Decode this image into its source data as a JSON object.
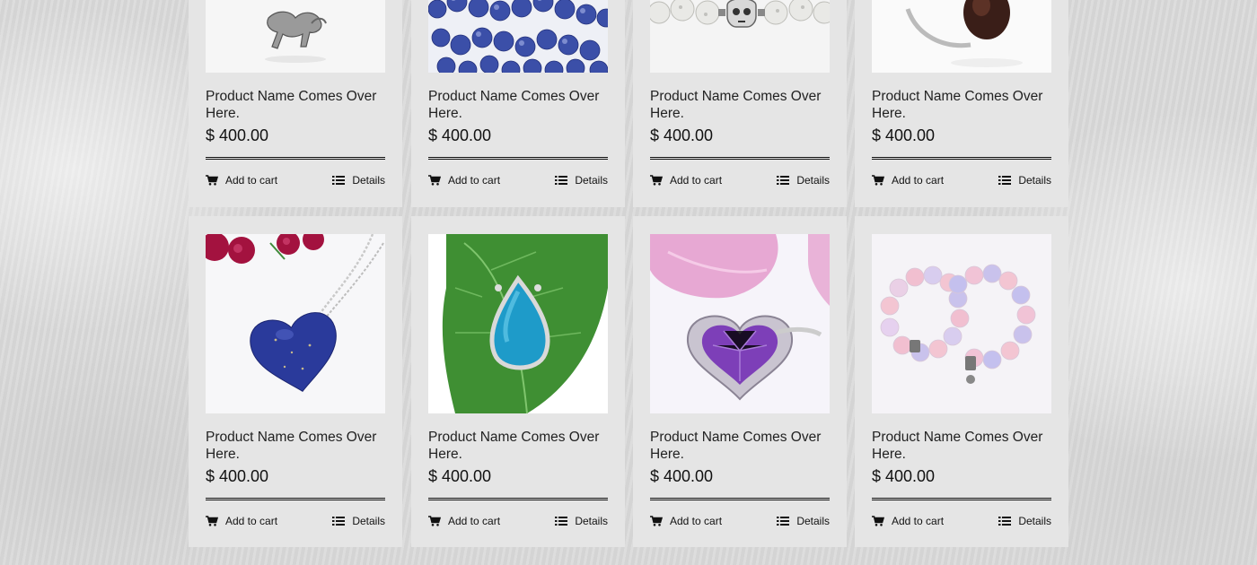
{
  "products": [
    {
      "name": "Product Name Comes Over Here.",
      "price": "$ 400.00",
      "add_to_cart": "Add to cart",
      "details": "Details",
      "image": "silver-horse-pendant"
    },
    {
      "name": "Product Name Comes Over Here.",
      "price": "$ 400.00",
      "add_to_cart": "Add to cart",
      "details": "Details",
      "image": "blue-bead-bracelet"
    },
    {
      "name": "Product Name Comes Over Here.",
      "price": "$ 400.00",
      "add_to_cart": "Add to cart",
      "details": "Details",
      "image": "skull-bead-bracelet"
    },
    {
      "name": "Product Name Comes Over Here.",
      "price": "$ 400.00",
      "add_to_cart": "Add to cart",
      "details": "Details",
      "image": "smoky-quartz-ring"
    },
    {
      "name": "Product Name Comes Over Here.",
      "price": "$ 400.00",
      "add_to_cart": "Add to cart",
      "details": "Details",
      "image": "lapis-heart-pendant"
    },
    {
      "name": "Product Name Comes Over Here.",
      "price": "$ 400.00",
      "add_to_cart": "Add to cart",
      "details": "Details",
      "image": "turquoise-ring-on-leaf"
    },
    {
      "name": "Product Name Comes Over Here.",
      "price": "$ 400.00",
      "add_to_cart": "Add to cart",
      "details": "Details",
      "image": "amethyst-heart-ring"
    },
    {
      "name": "Product Name Comes Over Here.",
      "price": "$ 400.00",
      "add_to_cart": "Add to cart",
      "details": "Details",
      "image": "pink-lavender-bead-bracelets"
    }
  ],
  "icons": {
    "cart": "cart-icon",
    "details": "list-icon"
  },
  "colors": {
    "card_bg": "#e5e5e5",
    "text": "#111111",
    "page_bg": "#d9d9d9"
  }
}
